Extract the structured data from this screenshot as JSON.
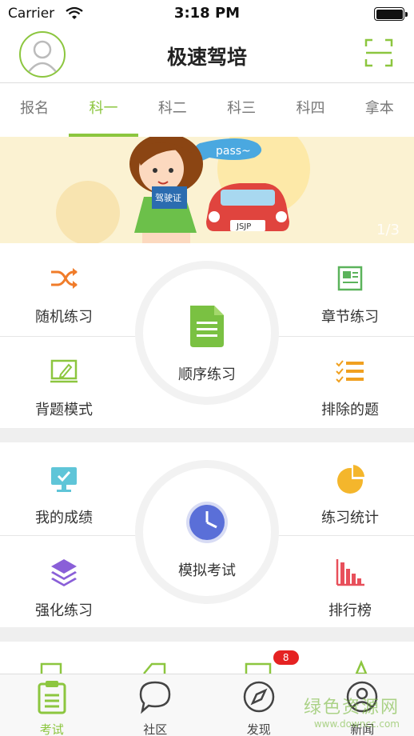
{
  "status_bar": {
    "carrier": "Carrier",
    "time": "3:18 PM"
  },
  "header": {
    "title": "极速驾培"
  },
  "tabs": [
    {
      "label": "报名",
      "active": false
    },
    {
      "label": "科一",
      "active": true
    },
    {
      "label": "科二",
      "active": false
    },
    {
      "label": "科三",
      "active": false
    },
    {
      "label": "科四",
      "active": false
    },
    {
      "label": "拿本",
      "active": false
    }
  ],
  "banner": {
    "bubble_text": "pass~",
    "card_text": "驾驶证",
    "plate_text": "JSJP",
    "counter": "1/3"
  },
  "practice": {
    "random": "随机练习",
    "chapter": "章节练习",
    "sequential": "顺序练习",
    "memorize": "背题模式",
    "exclude": "排除的题"
  },
  "exam": {
    "my_scores": "我的成绩",
    "statistics": "练习统计",
    "mock_exam": "模拟考试",
    "intensive": "强化练习",
    "ranking": "排行榜"
  },
  "bottom_nav": [
    {
      "label": "考试",
      "active": true
    },
    {
      "label": "社区",
      "active": false
    },
    {
      "label": "发现",
      "active": false,
      "badge": "8"
    },
    {
      "label": "新闻",
      "active": false
    }
  ],
  "watermark": {
    "line1": "绿色资源网",
    "line2": "www.downcc.com"
  },
  "colors": {
    "accent": "#8cc63f",
    "badge": "#e52222"
  }
}
